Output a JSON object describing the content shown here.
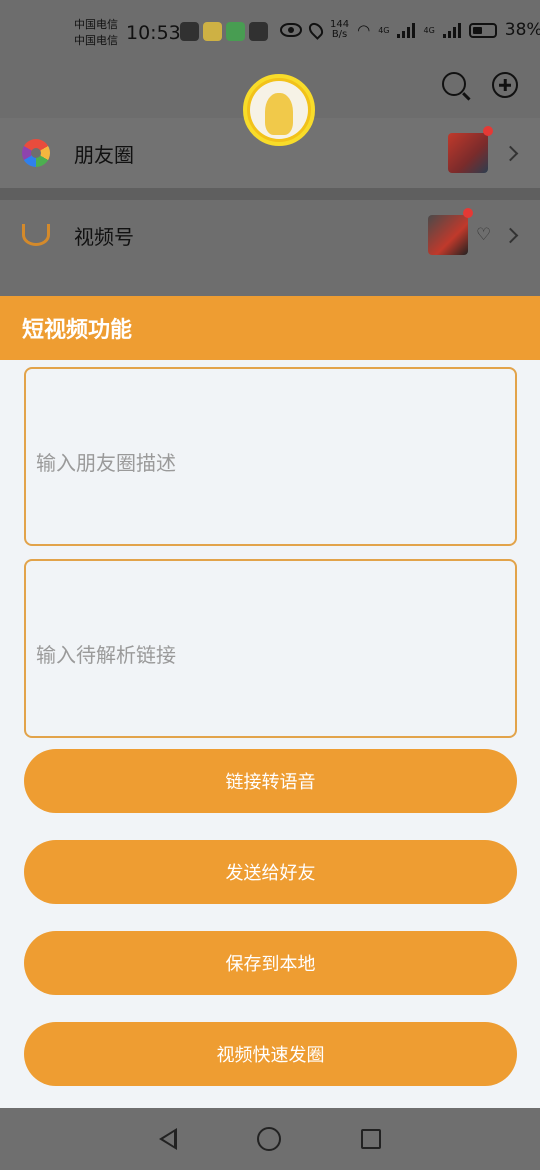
{
  "status_bar": {
    "carrier_1": "中国电信",
    "carrier_2": "中国电信",
    "time": "10:53",
    "speed_value": "144",
    "speed_unit": "B/s",
    "network_1": "4G",
    "network_2": "4G",
    "battery": "38%"
  },
  "background_app": {
    "rows": [
      {
        "label": "朋友圈",
        "icon": "moments-icon"
      },
      {
        "label": "视频号",
        "icon": "channels-icon"
      }
    ]
  },
  "panel": {
    "title": "短视频功能",
    "description_placeholder": "输入朋友圈描述",
    "link_placeholder": "输入待解析链接",
    "buttons": {
      "link_to_voice": "链接转语音",
      "send_to_friend": "发送给好友",
      "save_local": "保存到本地",
      "quick_post": "视频快速发圈"
    }
  },
  "colors": {
    "accent": "#ee9d32",
    "panel_bg": "#f1f4f7",
    "input_border": "#e2a34a"
  }
}
